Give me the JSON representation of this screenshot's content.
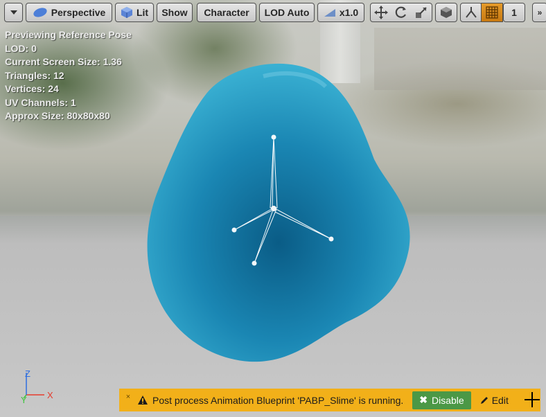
{
  "toolbar": {
    "menu_icon": "dropdown-arrow-icon",
    "perspective_label": "Perspective",
    "lit_label": "Lit",
    "show_label": "Show",
    "character_label": "Character",
    "lod_label": "LOD Auto",
    "speed_label": "x1.0",
    "layer_count": "1",
    "tool_icons": [
      "translate-icon",
      "rotate-icon",
      "scale-icon",
      "surface-snap-icon",
      "grid-snap-icon"
    ],
    "accent_color": "#d98a1c"
  },
  "stats": {
    "previewing": "Previewing Reference Pose",
    "lod": "LOD: 0",
    "screen_size": "Current Screen Size: 1.36",
    "triangles": "Triangles: 12",
    "vertices": "Vertices: 24",
    "uv_channels": "UV Channels: 1",
    "approx_size": "Approx Size: 80x80x80"
  },
  "axis": {
    "x": "X",
    "y": "Y",
    "z": "Z"
  },
  "notification": {
    "close": "×",
    "message": "Post process Animation Blueprint 'PABP_Slime' is running.",
    "disable_label": "Disable",
    "edit_label": "Edit",
    "bar_color": "#f2b019",
    "disable_color": "#4b9846"
  },
  "mesh": {
    "color": "#1e86b2",
    "skeleton_color": "#ffffff"
  }
}
